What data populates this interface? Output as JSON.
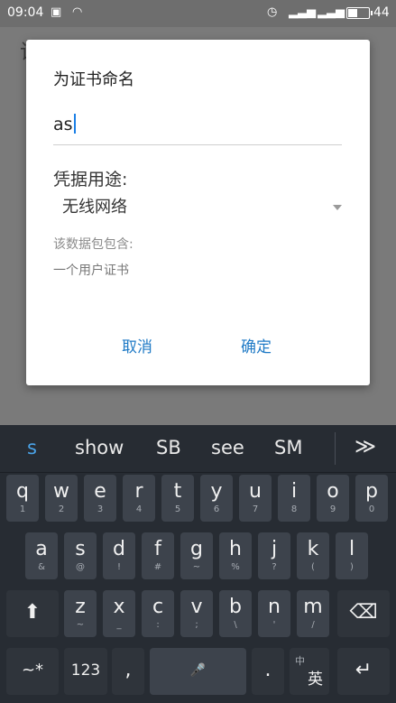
{
  "status_bar": {
    "time": "09:04",
    "battery": "44"
  },
  "background": {
    "title": "该"
  },
  "dialog": {
    "title": "为证书命名",
    "name_value": "as",
    "usage_label": "凭据用途:",
    "usage_selected": "无线网络",
    "package_label": "该数据包包含:",
    "package_value": "一个用户证书",
    "cancel_label": "取消",
    "ok_label": "确定"
  },
  "keyboard": {
    "suggestions": [
      "s",
      "show",
      "SB",
      "see",
      "SM"
    ],
    "more_label": "≫",
    "row1": [
      {
        "k": "q",
        "n": "1"
      },
      {
        "k": "w",
        "n": "2"
      },
      {
        "k": "e",
        "n": "3"
      },
      {
        "k": "r",
        "n": "4"
      },
      {
        "k": "t",
        "n": "5"
      },
      {
        "k": "y",
        "n": "6"
      },
      {
        "k": "u",
        "n": "7"
      },
      {
        "k": "i",
        "n": "8"
      },
      {
        "k": "o",
        "n": "9"
      },
      {
        "k": "p",
        "n": "0"
      }
    ],
    "row2": [
      {
        "k": "a",
        "n": "&"
      },
      {
        "k": "s",
        "n": "@"
      },
      {
        "k": "d",
        "n": "!"
      },
      {
        "k": "f",
        "n": "#"
      },
      {
        "k": "g",
        "n": "~"
      },
      {
        "k": "h",
        "n": "%"
      },
      {
        "k": "j",
        "n": "?"
      },
      {
        "k": "k",
        "n": "("
      },
      {
        "k": "l",
        "n": ")"
      }
    ],
    "row3": [
      {
        "k": "z",
        "n": "~"
      },
      {
        "k": "x",
        "n": "_"
      },
      {
        "k": "c",
        "n": ":"
      },
      {
        "k": "v",
        "n": ";"
      },
      {
        "k": "b",
        "n": "\\"
      },
      {
        "k": "n",
        "n": "'"
      },
      {
        "k": "m",
        "n": "/"
      }
    ],
    "symbols_label": "~*",
    "numbers_label": "123",
    "comma_label": ",",
    "period_label": ".",
    "lang_small": "中",
    "lang_main": "英",
    "shift_icon": "⬆",
    "backspace_icon": "⌫",
    "enter_icon": "↵",
    "space_icon": "🎤"
  }
}
